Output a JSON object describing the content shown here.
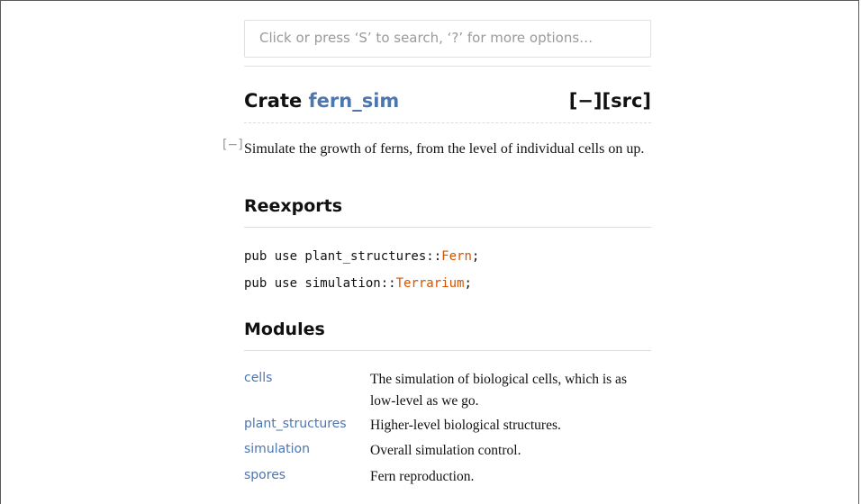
{
  "search": {
    "placeholder": "Click or press ‘S’ to search, ‘?’ for more options…"
  },
  "crate": {
    "keyword": "Crate",
    "name": "fern_sim",
    "controls": "[−][src]"
  },
  "doc": {
    "toggle": "[−]",
    "summary": "Simulate the growth of ferns, from the level of individual cells on up."
  },
  "reexports": {
    "heading": "Reexports",
    "items": [
      {
        "prefix": "pub use plant_structures::",
        "type": "Fern",
        "suffix": ";"
      },
      {
        "prefix": "pub use simulation::",
        "type": "Terrarium",
        "suffix": ";"
      }
    ]
  },
  "modules": {
    "heading": "Modules",
    "items": [
      {
        "name": "cells",
        "desc": "The simulation of biological cells, which is as low-level as we go."
      },
      {
        "name": "plant_structures",
        "desc": "Higher-level biological structures."
      },
      {
        "name": "simulation",
        "desc": "Overall simulation control."
      },
      {
        "name": "spores",
        "desc": "Fern reproduction."
      }
    ]
  }
}
